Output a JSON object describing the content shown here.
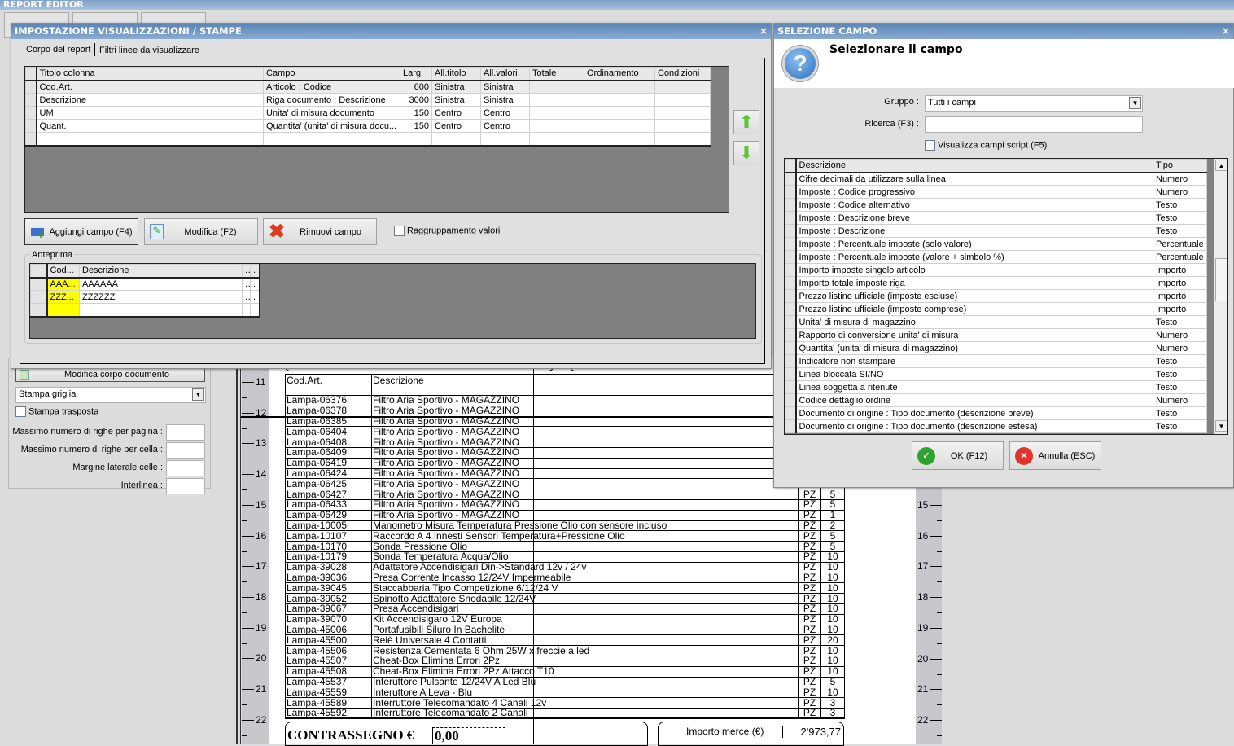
{
  "app": {
    "title": "REPORT EDITOR"
  },
  "left_panel": {
    "edit_body_button": "Modifica corpo documento",
    "print_mode": "Stampa griglia",
    "transposed_label": "Stampa trasposta",
    "fields": [
      {
        "label": "Massimo numero di righe per pagina :",
        "value": ""
      },
      {
        "label": "Massimo numero di righe per cella :",
        "value": ""
      },
      {
        "label": "Margine laterale celle :",
        "value": ""
      },
      {
        "label": "Interlinea :",
        "value": ""
      }
    ]
  },
  "settings_dialog": {
    "title": "IMPOSTAZIONE VISUALIZZAZIONI / STAMPE",
    "tabs": [
      "Corpo del report",
      "Filtri linee da visualizzare"
    ],
    "columns": [
      "Titolo colonna",
      "Campo",
      "Larg.",
      "All.titolo",
      "All.valori",
      "Totale",
      "Ordinamento",
      "Condizioni"
    ],
    "rows": [
      [
        "Cod.Art.",
        "Articolo : Codice",
        "600",
        "Sinistra",
        "Sinistra",
        "",
        "",
        ""
      ],
      [
        "Descrizione",
        "Riga documento : Descrizione",
        "3000",
        "Sinistra",
        "Sinistra",
        "",
        "",
        ""
      ],
      [
        "UM",
        "Unita' di misura documento",
        "150",
        "Centro",
        "Centro",
        "",
        "",
        ""
      ],
      [
        "Quant.",
        "Quantita' (unita' di misura docu...",
        "150",
        "Centro",
        "Centro",
        "",
        "",
        ""
      ],
      [
        "",
        "",
        "",
        "",
        "",
        "",
        "",
        ""
      ]
    ],
    "add_button": "Aggiungi campo (F4)",
    "edit_button": "Modifica (F2)",
    "remove_button": "Rimuovi campo",
    "group_values_label": "Raggruppamento valori",
    "preview": {
      "label": "Anteprima",
      "columns": [
        "Cod...",
        "Descrizione",
        ".",
        "."
      ],
      "rows": [
        [
          "AAA...",
          "AAAAAA",
          ".",
          "."
        ],
        [
          "ZZZ...",
          "ZZZZZZ",
          ".",
          "."
        ],
        [
          "",
          "",
          "",
          ""
        ]
      ]
    }
  },
  "field_dialog": {
    "title": "SELEZIONE CAMPO",
    "heading": "Selezionare il campo",
    "group_label": "Gruppo :",
    "group_value": "Tutti i campi",
    "search_label": "Ricerca (F3) :",
    "search_value": "",
    "script_label": "Visualizza campi script (F5)",
    "columns": [
      "Descrizione",
      "Tipo"
    ],
    "rows": [
      [
        "Cifre decimali da utilizzare sulla linea",
        "Numero"
      ],
      [
        "Imposte : Codice progressivo",
        "Numero"
      ],
      [
        "Imposte : Codice alternativo",
        "Testo"
      ],
      [
        "Imposte : Descrizione breve",
        "Testo"
      ],
      [
        "Imposte : Descrizione",
        "Testo"
      ],
      [
        "Imposte : Percentuale imposte (solo valore)",
        "Percentuale"
      ],
      [
        "Imposte : Percentuale imposte (valore + simbolo %)",
        "Percentuale"
      ],
      [
        "Importo imposte singolo articolo",
        "Importo"
      ],
      [
        "Importo totale imposte riga",
        "Importo"
      ],
      [
        "Prezzo listino ufficiale (imposte escluse)",
        "Importo"
      ],
      [
        "Prezzo listino ufficiale (imposte comprese)",
        "Importo"
      ],
      [
        "Unita' di misura di magazzino",
        "Testo"
      ],
      [
        "Rapporto di conversione unita' di misura",
        "Numero"
      ],
      [
        "Quantita' (unita' di misura di magazzino)",
        "Numero"
      ],
      [
        "Indicatore non stampare",
        "Testo"
      ],
      [
        "Linea bloccata SI/NO",
        "Testo"
      ],
      [
        "Linea soggetta a ritenute",
        "Testo"
      ],
      [
        "Codice dettaglio ordine",
        "Numero"
      ],
      [
        "Documento di origine : Tipo documento (descrizione breve)",
        "Testo"
      ],
      [
        "Documento di origine : Tipo documento (descrizione estesa)",
        "Testo"
      ]
    ],
    "ok_button": "OK (F12)",
    "cancel_button": "Annulla (ESC)"
  },
  "document": {
    "headers": [
      "Cod.Art.",
      "Descrizione",
      "",
      ""
    ],
    "rows": [
      [
        "Lampa-06376",
        "Filtro Aria Sportivo - MAGAZZINO",
        "",
        ""
      ],
      [
        "Lampa-06378",
        "Filtro Aria Sportivo - MAGAZZINO",
        "",
        ""
      ],
      [
        "Lampa-06385",
        "Filtro Aria Sportivo - MAGAZZINO",
        "",
        ""
      ],
      [
        "Lampa-06404",
        "Filtro Aria Sportivo - MAGAZZINO",
        "",
        ""
      ],
      [
        "Lampa-06408",
        "Filtro Aria Sportivo - MAGAZZINO",
        "",
        ""
      ],
      [
        "Lampa-06409",
        "Filtro Aria Sportivo - MAGAZZINO",
        "",
        ""
      ],
      [
        "Lampa-06419",
        "Filtro Aria Sportivo - MAGAZZINO",
        "",
        ""
      ],
      [
        "Lampa-06424",
        "Filtro Aria Sportivo - MAGAZZINO",
        "",
        ""
      ],
      [
        "Lampa-06425",
        "Filtro Aria Sportivo - MAGAZZINO",
        "",
        ""
      ],
      [
        "Lampa-06427",
        "Filtro Aria Sportivo - MAGAZZINO",
        "PZ",
        "5"
      ],
      [
        "Lampa-06433",
        "Filtro Aria Sportivo - MAGAZZINO",
        "PZ",
        "5"
      ],
      [
        "Lampa-06429",
        "Filtro Aria Sportivo - MAGAZZINO",
        "PZ",
        "1"
      ],
      [
        "Lampa-10005",
        "Manometro Misura Temperatura Pressione Olio con sensore incluso",
        "PZ",
        "2"
      ],
      [
        "Lampa-10107",
        "Raccordo A 4 Innesti Sensori Temperatura+Pressione Olio",
        "PZ",
        "5"
      ],
      [
        "Lampa-10170",
        "Sonda Pressione Olio",
        "PZ",
        "5"
      ],
      [
        "Lampa-10179",
        "Sonda Temperatura Acqua/Olio",
        "PZ",
        "10"
      ],
      [
        "Lampa-39028",
        "Adattatore Accendisigari Din->Standard 12v / 24v",
        "PZ",
        "10"
      ],
      [
        "Lampa-39036",
        "Presa Corrente Incasso 12/24V Impermeabile",
        "PZ",
        "10"
      ],
      [
        "Lampa-39045",
        "Staccabbaria Tipo Competizione 6/12/24 V",
        "PZ",
        "10"
      ],
      [
        "Lampa-39052",
        "Spinotto Adattatore Snodabile 12/24V",
        "PZ",
        "10"
      ],
      [
        "Lampa-39067",
        "Presa Accendisigari",
        "PZ",
        "10"
      ],
      [
        "Lampa-39070",
        "Kit Accendisigaro 12V Europa",
        "PZ",
        "10"
      ],
      [
        "Lampa-45006",
        "Portafusibili Siluro In Bachelite",
        "PZ",
        "10"
      ],
      [
        "Lampa-45500",
        "Relè Universale 4 Contatti",
        "PZ",
        "20"
      ],
      [
        "Lampa-45506",
        "Resistenza Cementata 6 Ohm 25W x freccie a led",
        "PZ",
        "10"
      ],
      [
        "Lampa-45507",
        "Cheat-Box Elimina Errori 2Pz",
        "PZ",
        "10"
      ],
      [
        "Lampa-45508",
        "Cheat-Box Elimina Errori 2Pz Attacco T10",
        "PZ",
        "10"
      ],
      [
        "Lampa-45537",
        "Interuttore Pulsante 12/24V A Led Blu",
        "PZ",
        "5"
      ],
      [
        "Lampa-45559",
        "Interuttore A Leva - Blu",
        "PZ",
        "10"
      ],
      [
        "Lampa-45589",
        "Interruttore Telecomandato 4 Canali 12v",
        "PZ",
        "3"
      ],
      [
        "Lampa-45592",
        "Interruttore Telecomandato 2 Canali",
        "PZ",
        "3"
      ]
    ],
    "cod_label": "CONTRASSEGNO €",
    "cod_value": "0,00",
    "goods_label": "Importo merce (€)",
    "goods_value": "2'973,77"
  },
  "rulers": {
    "left": [
      "11",
      "12",
      "13",
      "14",
      "15",
      "16",
      "17",
      "18",
      "19",
      "20",
      "21",
      "22"
    ],
    "right": [
      "15",
      "16",
      "17",
      "18",
      "19",
      "20",
      "21",
      "22"
    ]
  }
}
